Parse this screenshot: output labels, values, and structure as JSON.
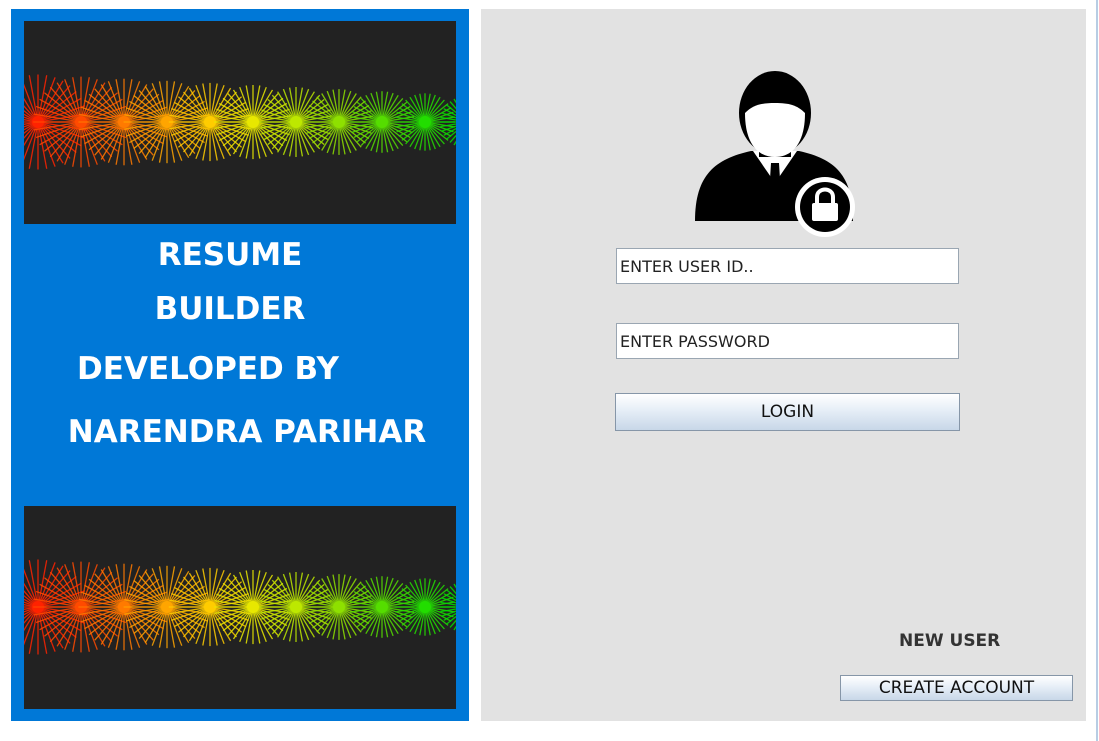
{
  "left_panel": {
    "title_line1": "RESUME",
    "title_line2": "BUILDER",
    "title_line3": "DEVELOPED BY",
    "title_line4": "NARENDRA PARIHAR"
  },
  "login": {
    "user_id_value": "ENTER USER ID..",
    "password_value": "ENTER PASSWORD",
    "login_label": "LOGIN"
  },
  "signup": {
    "new_user_label": "NEW USER",
    "create_account_label": "CREATE ACCOUNT"
  },
  "colors": {
    "panel_blue": "#0078d7",
    "panel_gray": "#e2e2e2",
    "banner_dark": "#222222"
  },
  "icons": {
    "user_lock": "user-lock-icon",
    "banner": "spark-banner-image"
  }
}
